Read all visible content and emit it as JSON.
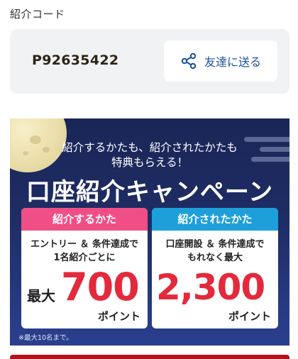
{
  "referral": {
    "section_label": "紹介コード",
    "code": "P92635422",
    "share_label": "友達に送る",
    "share_icon": "share-icon"
  },
  "banner": {
    "subtitle_line1": "紹介するかたも、紹介されたかたも",
    "subtitle_line2": "特典もらえる！",
    "title": "口座紹介キャンペーン",
    "referrer": {
      "heading": "紹介するかた",
      "heading_color": "#ef4f86",
      "desc_line1": "エントリー ＆ 条件達成で",
      "desc_line2": "1名紹介ごとに",
      "max_label": "最大",
      "amount": "700",
      "unit": "ポイント"
    },
    "referee": {
      "heading": "紹介されたかた",
      "heading_color": "#1e9fd9",
      "desc_line1": "口座開設 ＆ 条件達成で",
      "desc_line2": "もれなく最大",
      "amount": "2,300",
      "unit": "ポイント"
    },
    "note": "※最大10名まで。"
  },
  "colors": {
    "accent_red": "#e32a3c",
    "link_blue": "#1b4f9c",
    "banner_navy": "#1f2d66"
  }
}
